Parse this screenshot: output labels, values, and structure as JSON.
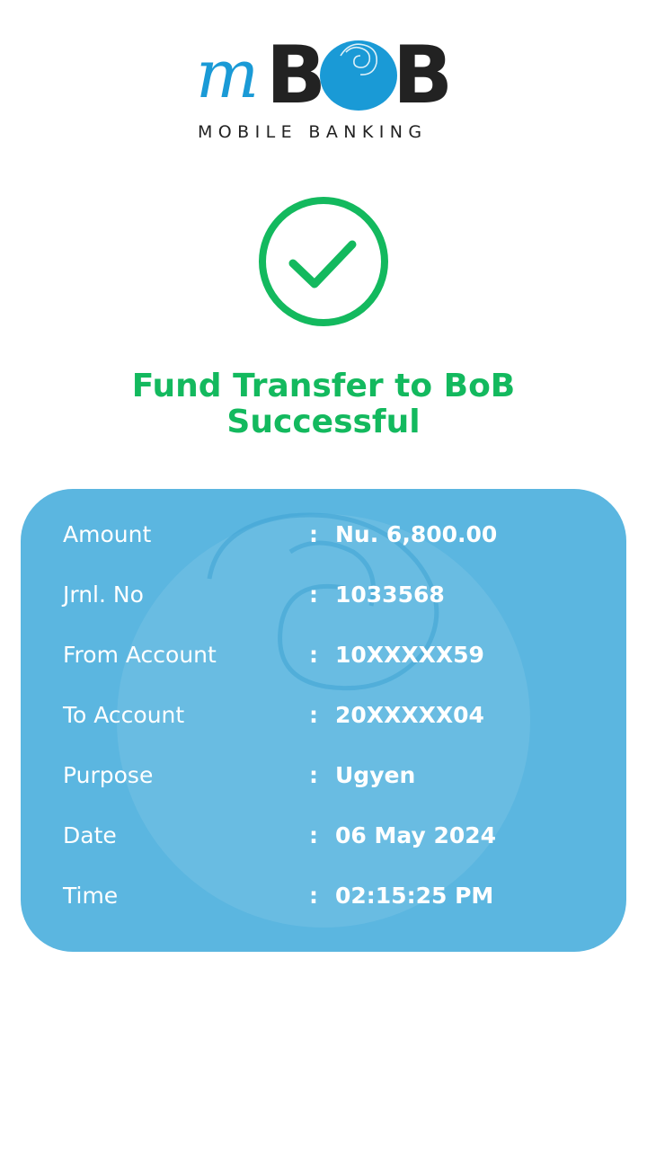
{
  "logo": {
    "prefix": "m",
    "brand_b1": "B",
    "brand_b2": "B",
    "subtitle": "MOBILE BANKING",
    "brand_blue": "#1a9ad6",
    "brand_dark": "#222222"
  },
  "status": {
    "icon": "check-circle-icon",
    "color": "#13b95e",
    "title_line1": "Fund Transfer to BoB",
    "title_line2": "Successful"
  },
  "card": {
    "background": "#5bb6e0",
    "separator": ":",
    "rows": [
      {
        "label": "Amount",
        "value": "Nu. 6,800.00"
      },
      {
        "label": "Jrnl. No",
        "value": "1033568"
      },
      {
        "label": "From Account",
        "value": "10XXXXX59"
      },
      {
        "label": "To Account",
        "value": "20XXXXX04"
      },
      {
        "label": "Purpose",
        "value": "Ugyen"
      },
      {
        "label": "Date",
        "value": "06 May 2024"
      },
      {
        "label": "Time",
        "value": "02:15:25 PM"
      }
    ]
  }
}
